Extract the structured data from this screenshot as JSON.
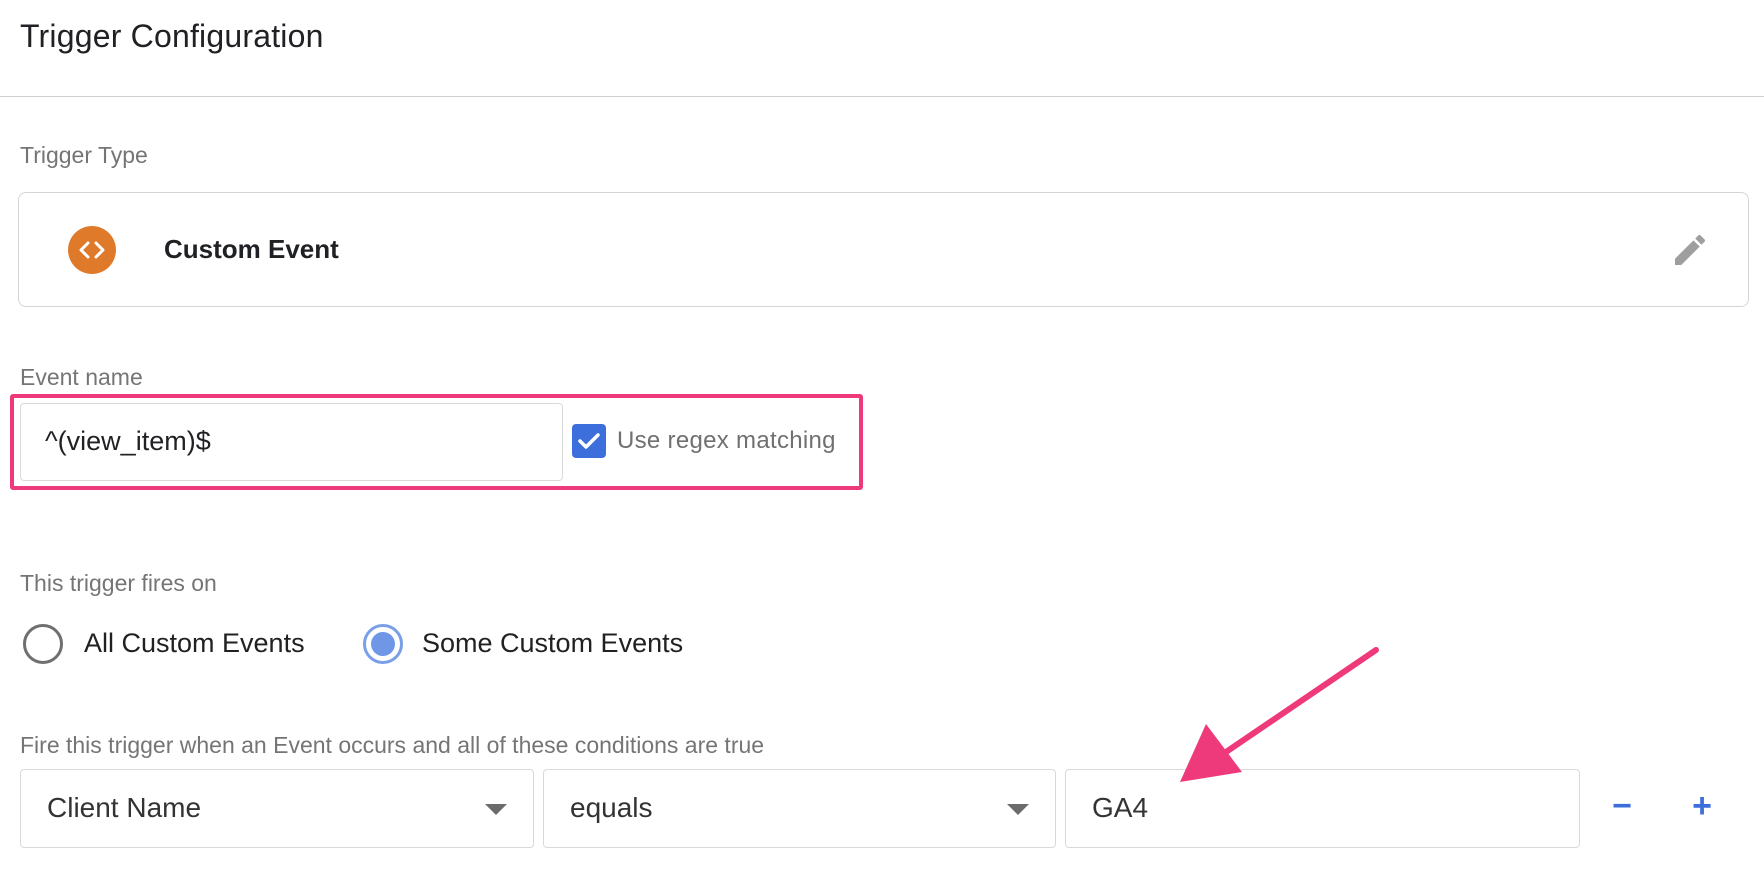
{
  "header": {
    "title": "Trigger Configuration"
  },
  "trigger_type": {
    "label": "Trigger Type",
    "name": "Custom Event",
    "icon": "code-brackets-icon",
    "icon_color": "#e07a2b",
    "edit_icon": "pencil-icon"
  },
  "event_name": {
    "label": "Event name",
    "value": "^(view_item)$",
    "regex_label": "Use regex matching",
    "regex_checked": true,
    "highlight_color": "#ee3a7a"
  },
  "fires_on": {
    "label": "This trigger fires on",
    "options": [
      {
        "label": "All Custom Events",
        "selected": false
      },
      {
        "label": "Some Custom Events",
        "selected": true
      }
    ]
  },
  "conditions": {
    "label": "Fire this trigger when an Event occurs and all of these conditions are true",
    "rows": [
      {
        "variable": "Client Name",
        "operator": "equals",
        "value": "GA4"
      }
    ],
    "remove_label": "−",
    "add_label": "+"
  },
  "colors": {
    "accent": "#3d6fdc",
    "annotation": "#ee3a7a"
  }
}
